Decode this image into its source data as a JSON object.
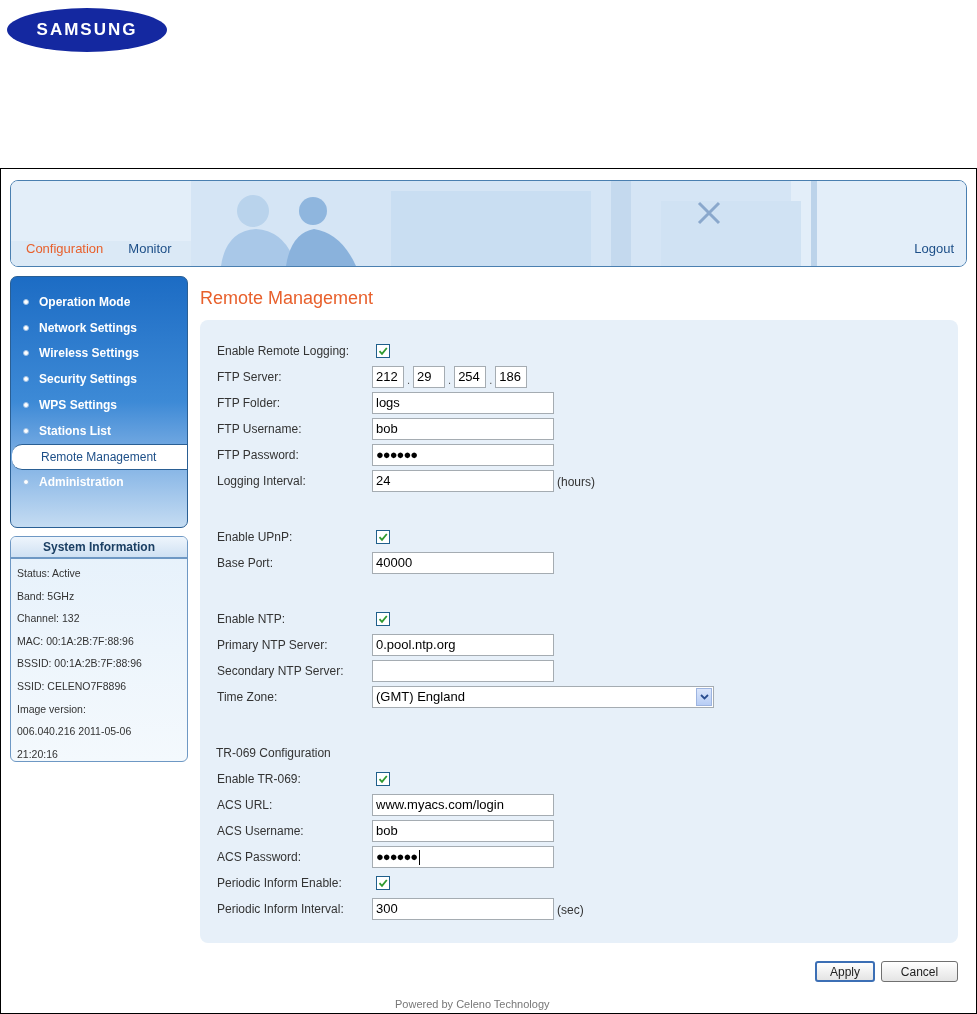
{
  "logo": {
    "text": "SAMSUNG"
  },
  "header": {
    "tabs": [
      {
        "label": "Configuration",
        "selected": true
      },
      {
        "label": "Monitor",
        "selected": false
      }
    ],
    "logout": "Logout"
  },
  "sidebar": {
    "items": [
      {
        "label": "Operation Mode",
        "selected": false
      },
      {
        "label": "Network Settings",
        "selected": false
      },
      {
        "label": "Wireless Settings",
        "selected": false
      },
      {
        "label": "Security Settings",
        "selected": false
      },
      {
        "label": "WPS Settings",
        "selected": false
      },
      {
        "label": "Stations List",
        "selected": false
      },
      {
        "label": "Remote Management",
        "selected": true
      },
      {
        "label": "Administration",
        "selected": false
      }
    ]
  },
  "system_info": {
    "title": "System Information",
    "lines": [
      "Status: Active",
      "Band: 5GHz",
      "Channel: 132",
      "MAC: 00:1A:2B:7F:88:96",
      "BSSID: 00:1A:2B:7F:88:96",
      "SSID: CELENO7F8896",
      "Image version:",
      "006.040.216 2011-05-06",
      "21:20:16"
    ]
  },
  "page_title": "Remote Management",
  "sections": [
    {
      "rows": [
        {
          "kind": "checkbox",
          "label": "Enable Remote Logging:",
          "checked": true
        },
        {
          "kind": "ip",
          "label": "FTP Server:",
          "octets": [
            "212",
            "29",
            "254",
            "186"
          ],
          "separator": "."
        },
        {
          "kind": "text",
          "label": "FTP Folder:",
          "value": "logs"
        },
        {
          "kind": "text",
          "label": "FTP Username:",
          "value": "bob"
        },
        {
          "kind": "password",
          "label": "FTP Password:",
          "value": "●●●●●●"
        },
        {
          "kind": "text",
          "label": "Logging Interval:",
          "value": "24",
          "suffix": "(hours)"
        }
      ]
    },
    {
      "rows": [
        {
          "kind": "checkbox",
          "label": "Enable UPnP:",
          "checked": true
        },
        {
          "kind": "text",
          "label": "Base Port:",
          "value": "40000"
        }
      ]
    },
    {
      "rows": [
        {
          "kind": "checkbox",
          "label": "Enable NTP:",
          "checked": true
        },
        {
          "kind": "text",
          "label": "Primary NTP Server:",
          "value": "0.pool.ntp.org"
        },
        {
          "kind": "text",
          "label": "Secondary NTP Server:"
        },
        {
          "kind": "select",
          "label": "Time Zone:",
          "value": "(GMT) England"
        }
      ]
    },
    {
      "heading": "TR-069 Configuration",
      "rows": [
        {
          "kind": "checkbox",
          "label": "Enable TR-069:",
          "checked": true
        },
        {
          "kind": "text",
          "label": "ACS URL:",
          "value": "www.myacs.com/login"
        },
        {
          "kind": "text",
          "label": "ACS Username:",
          "value": "bob"
        },
        {
          "kind": "password",
          "label": "ACS Password:",
          "value": "●●●●●●",
          "caret": true
        },
        {
          "kind": "checkbox",
          "label": "Periodic Inform Enable:",
          "checked": true
        },
        {
          "kind": "text",
          "label": "Periodic Inform Interval:",
          "value": "300",
          "suffix": "(sec)"
        }
      ]
    }
  ],
  "buttons": [
    {
      "label": "Apply",
      "kind": "primary"
    },
    {
      "label": "Cancel",
      "kind": "normal"
    }
  ],
  "footer": "Powered by Celeno Technology"
}
